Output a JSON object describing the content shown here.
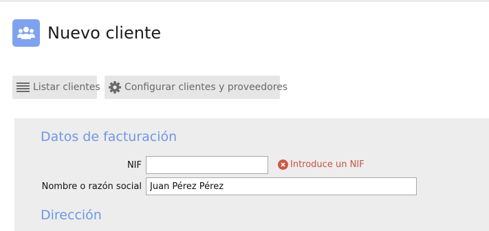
{
  "header": {
    "title": "Nuevo cliente",
    "icon": "users-icon",
    "icon_bg": "#7ea2ee"
  },
  "toolbar": {
    "list_label": "Listar clientes",
    "list_icon": "list-icon",
    "config_label": "Configurar clientes y proveedores",
    "config_icon": "gear-icon"
  },
  "form": {
    "billing_title": "Datos de facturación",
    "nif_label": "NIF",
    "nif_value": "",
    "nif_error": "Introduce un NIF",
    "name_label": "Nombre o razón social",
    "name_value": "Juan Pérez Pérez",
    "address_title": "Dirección"
  },
  "colors": {
    "accent": "#6f97e5",
    "error": "#c9523f",
    "panel_bg": "#ededed",
    "button_bg": "#e6e6e6"
  }
}
